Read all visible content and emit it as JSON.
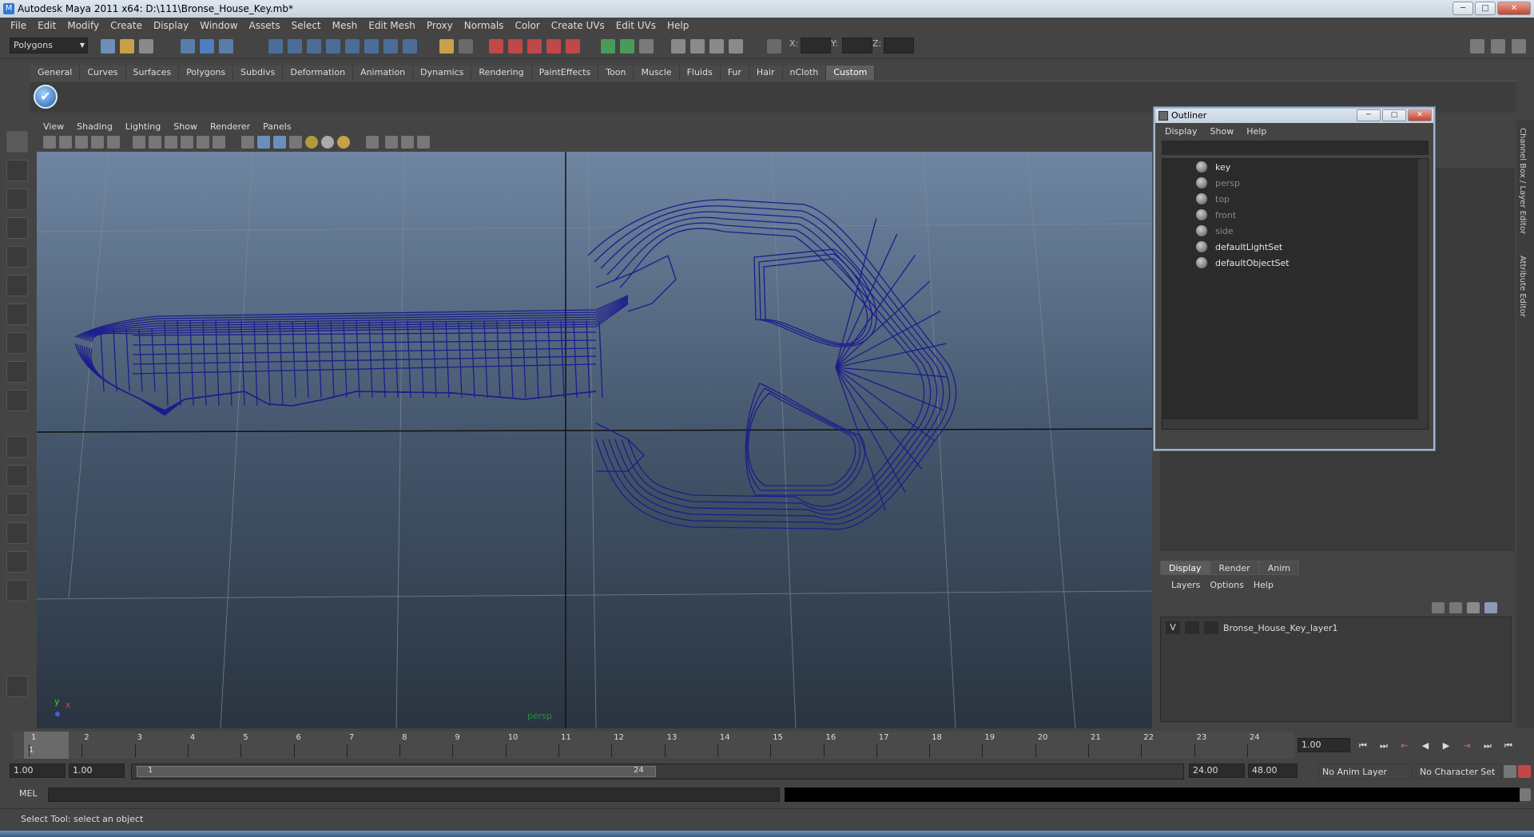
{
  "titlebar": {
    "title": "Autodesk Maya 2011 x64: D:\\111\\Bronse_House_Key.mb*",
    "app_icon": "M",
    "minimize": "─",
    "maximize": "□",
    "close": "✕"
  },
  "menubar": [
    "File",
    "Edit",
    "Modify",
    "Create",
    "Display",
    "Window",
    "Assets",
    "Select",
    "Mesh",
    "Edit Mesh",
    "Proxy",
    "Normals",
    "Color",
    "Create UVs",
    "Edit UVs",
    "Help"
  ],
  "statusline": {
    "mode": "Polygons",
    "x_label": "X:",
    "y_label": "Y:",
    "z_label": "Z:"
  },
  "shelf": {
    "tabs": [
      "General",
      "Curves",
      "Surfaces",
      "Polygons",
      "Subdivs",
      "Deformation",
      "Animation",
      "Dynamics",
      "Rendering",
      "PaintEffects",
      "Toon",
      "Muscle",
      "Fluids",
      "Fur",
      "Hair",
      "nCloth",
      "Custom"
    ],
    "active_tab": "Custom",
    "check_glyph": "✔"
  },
  "viewport": {
    "menus": [
      "View",
      "Shading",
      "Lighting",
      "Show",
      "Renderer",
      "Panels"
    ],
    "camera_label": "persp",
    "axis_y": "y",
    "axis_x": "x",
    "wire_color": "#1c1c8c"
  },
  "outliner": {
    "title": "Outliner",
    "menus": [
      "Display",
      "Show",
      "Help"
    ],
    "items": [
      {
        "name": "key",
        "dim": false
      },
      {
        "name": "persp",
        "dim": true
      },
      {
        "name": "top",
        "dim": true
      },
      {
        "name": "front",
        "dim": true
      },
      {
        "name": "side",
        "dim": true
      },
      {
        "name": "defaultLightSet",
        "dim": false
      },
      {
        "name": "defaultObjectSet",
        "dim": false
      }
    ],
    "minimize": "─",
    "maximize": "□",
    "close": "✕"
  },
  "layer_editor": {
    "tabs": [
      "Display",
      "Render",
      "Anim"
    ],
    "active_tab": "Display",
    "menus": [
      "Layers",
      "Options",
      "Help"
    ],
    "layer": {
      "visible": "V",
      "name": "Bronse_House_Key_layer1"
    }
  },
  "right_strip": {
    "channel_box": "Channel Box / Layer Editor",
    "attribute_editor": "Attribute Editor"
  },
  "timeline": {
    "ticks": [
      "1",
      "2",
      "3",
      "4",
      "5",
      "6",
      "7",
      "8",
      "9",
      "10",
      "11",
      "12",
      "13",
      "14",
      "15",
      "16",
      "17",
      "18",
      "19",
      "20",
      "21",
      "22",
      "23",
      "24"
    ],
    "current_frame": "1",
    "current_time_field": "1.00",
    "playback": [
      "⏮",
      "⏭",
      "⇤",
      "◀",
      "▶",
      "⇥",
      "⏭",
      "⏮"
    ]
  },
  "range": {
    "start_time": "1.00",
    "playback_start": "1.00",
    "range_start": "1",
    "range_end": "24",
    "playback_end": "24.00",
    "end_time": "48.00",
    "anim_layer": "No Anim Layer",
    "character_set": "No Character Set"
  },
  "command": {
    "label": "MEL"
  },
  "help": {
    "text": "Select Tool: select an object"
  }
}
